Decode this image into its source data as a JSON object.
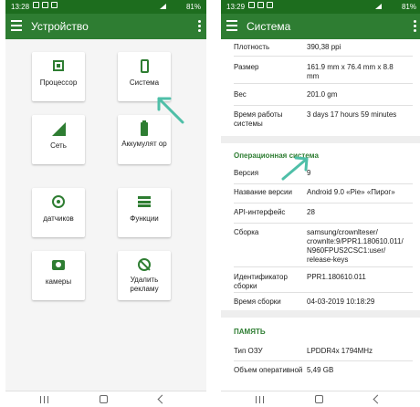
{
  "left": {
    "status": {
      "time": "13:28",
      "battery": "81%"
    },
    "appbar": {
      "title": "Устройство"
    },
    "tiles": [
      {
        "label": "Процессор",
        "icon": "cpu-icon"
      },
      {
        "label": "Система",
        "icon": "phone-icon"
      },
      {
        "label": "Сеть",
        "icon": "signal-icon"
      },
      {
        "label": "Аккумулят ор",
        "icon": "battery-icon"
      },
      {
        "label": "датчиков",
        "icon": "sensor-icon"
      },
      {
        "label": "Функции",
        "icon": "list-icon"
      },
      {
        "label": "камеры",
        "icon": "camera-icon"
      },
      {
        "label": "Удалить рекламу",
        "icon": "no-ads-icon"
      }
    ]
  },
  "right": {
    "status": {
      "time": "13:29",
      "battery": "81%"
    },
    "appbar": {
      "title": "Система"
    },
    "rows_top": [
      {
        "k": "Плотность",
        "v": "390,38 ppi"
      },
      {
        "k": "Размер",
        "v": "161.9 mm x 76.4 mm x 8.8 mm"
      },
      {
        "k": "Вес",
        "v": "201.0 gm"
      },
      {
        "k": "Время работы системы",
        "v": "3 days 17 hours 59 minutes"
      }
    ],
    "section_os": "Операционная система",
    "rows_os": [
      {
        "k": "Версия",
        "v": "9"
      },
      {
        "k": "Название версии",
        "v": "Android 9.0 «Pie» «Пирог»"
      },
      {
        "k": "API-интерфейс",
        "v": "28"
      },
      {
        "k": "Сборка",
        "v": "samsung/crownlteser/ crownlte:9/PPR1.180610.011/ N960FPUS2CSC1:user/ release-keys"
      },
      {
        "k": "Идентификатор сборки",
        "v": "PPR1.180610.011"
      },
      {
        "k": "Время сборки",
        "v": "04-03-2019 10:18:29"
      }
    ],
    "section_mem": "ПАМЯТЬ",
    "rows_mem": [
      {
        "k": "Тип ОЗУ",
        "v": "LPDDR4x 1794MHz"
      },
      {
        "k": "Объем оперативной",
        "v": "5,49 GB"
      }
    ]
  },
  "colors": {
    "primary": "#2e7d32",
    "statusbar": "#1d6d1e",
    "arrow": "#4fbfa8"
  }
}
